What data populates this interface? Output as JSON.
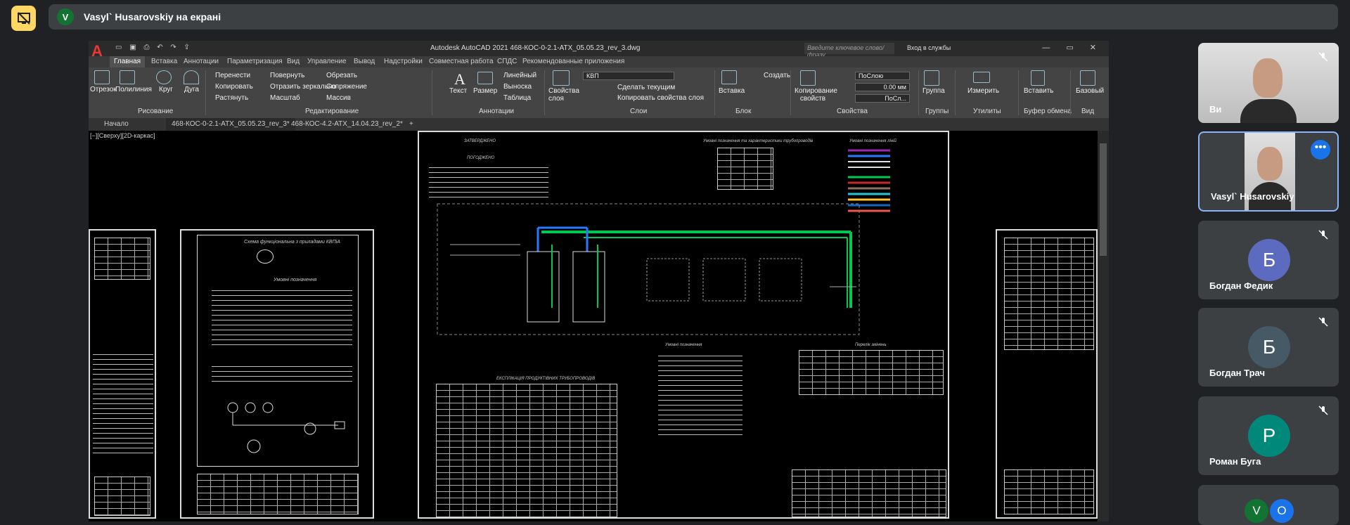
{
  "presenter": {
    "initial": "V",
    "banner": "Vasyl` Husarovskiy на екрані"
  },
  "autocad": {
    "window_title": "Autodesk AutoCAD 2021   468-КОС-0-2.1-АТХ_05.05.23_rev_3.dwg",
    "search_placeholder": "Введите ключевое слово/фразу",
    "signin": "Вход в службы",
    "ribbon_tabs": [
      "Главная",
      "Вставка",
      "Аннотации",
      "Параметризация",
      "Вид",
      "Управление",
      "Вывод",
      "Надстройки",
      "Совместная работа",
      "СПДС",
      "Рекомендованные приложения"
    ],
    "draw": {
      "line": "Отрезок",
      "polyline": "Полилиния",
      "circle": "Круг",
      "arc": "Дуга",
      "group": "Рисование"
    },
    "modify": {
      "move": "Перенести",
      "rotate": "Повернуть",
      "trim": "Обрезать",
      "copy": "Копировать",
      "mirror": "Отразить зеркально",
      "fillet": "Сопряжение",
      "stretch": "Растянуть",
      "scale": "Масштаб",
      "array": "Массив",
      "group": "Редактирование"
    },
    "annotation": {
      "text": "Текст",
      "dimension": "Размер",
      "linear": "Линейный",
      "leader": "Выноска",
      "table": "Таблица",
      "group": "Аннотации"
    },
    "layers": {
      "properties": "Свойства слоя",
      "current_layer": "КВП",
      "make_current": "Сделать текущим",
      "match": "Копировать свойства слоя",
      "group": "Слои"
    },
    "block": {
      "insert": "Вставка",
      "create": "Создать",
      "group": "Блок"
    },
    "properties": {
      "match": "Копирование свойств",
      "by_layer": "ПоСлою",
      "lineweight": "0.00 мм",
      "linetype": "ПоСл...",
      "group": "Свойства"
    },
    "groups": {
      "label": "Группа",
      "group": "Группы"
    },
    "utilities": {
      "measure": "Измерить",
      "group": "Утилиты"
    },
    "clipboard": {
      "paste": "Вставить",
      "group": "Буфер обмена"
    },
    "view": {
      "base": "Базовый",
      "group": "Вид"
    },
    "doc_tabs": [
      "Начало",
      "468-КОС-0-2.1-АТХ_05.05.23_rev_3*",
      "468-КОС-4.2-АТХ_14.04.23_rev_2*"
    ],
    "viewport_label": "[−][Сверху][2D-каркас]",
    "sheet_texts": {
      "approved": "ЗАТВЕРДЖЕНО",
      "agreed": "ПОГОДЖЕНО",
      "scheme_title": "Схема функціональна з приладами КВПіА",
      "conventions_title": "Умовні позначення",
      "pipe_conventions": "Умовні позначення та характеристики трубопроводів",
      "color_conventions": "Умовні позначення ліній",
      "pipe_spec": "ЕКСПЛІКАЦІЯ ПРОДУКТІВНИХ ТРУБОПРОВОДІВ",
      "changes": "Перелік змінень"
    }
  },
  "participants": [
    {
      "name": "Ви",
      "type": "camera"
    },
    {
      "name": "Vasyl` Husarovskiy",
      "type": "camera",
      "active": true
    },
    {
      "name": "Богдан Федик",
      "initial": "Б",
      "color": "#5c6bc0"
    },
    {
      "name": "Богдан Трач",
      "initial": "Б",
      "color": "#455a64"
    },
    {
      "name": "Роман Буга",
      "initial": "Р",
      "color": "#00897b"
    }
  ],
  "overflow": {
    "initials": [
      "V",
      "O"
    ],
    "colors": [
      "#137333",
      "#1a73e8"
    ]
  }
}
